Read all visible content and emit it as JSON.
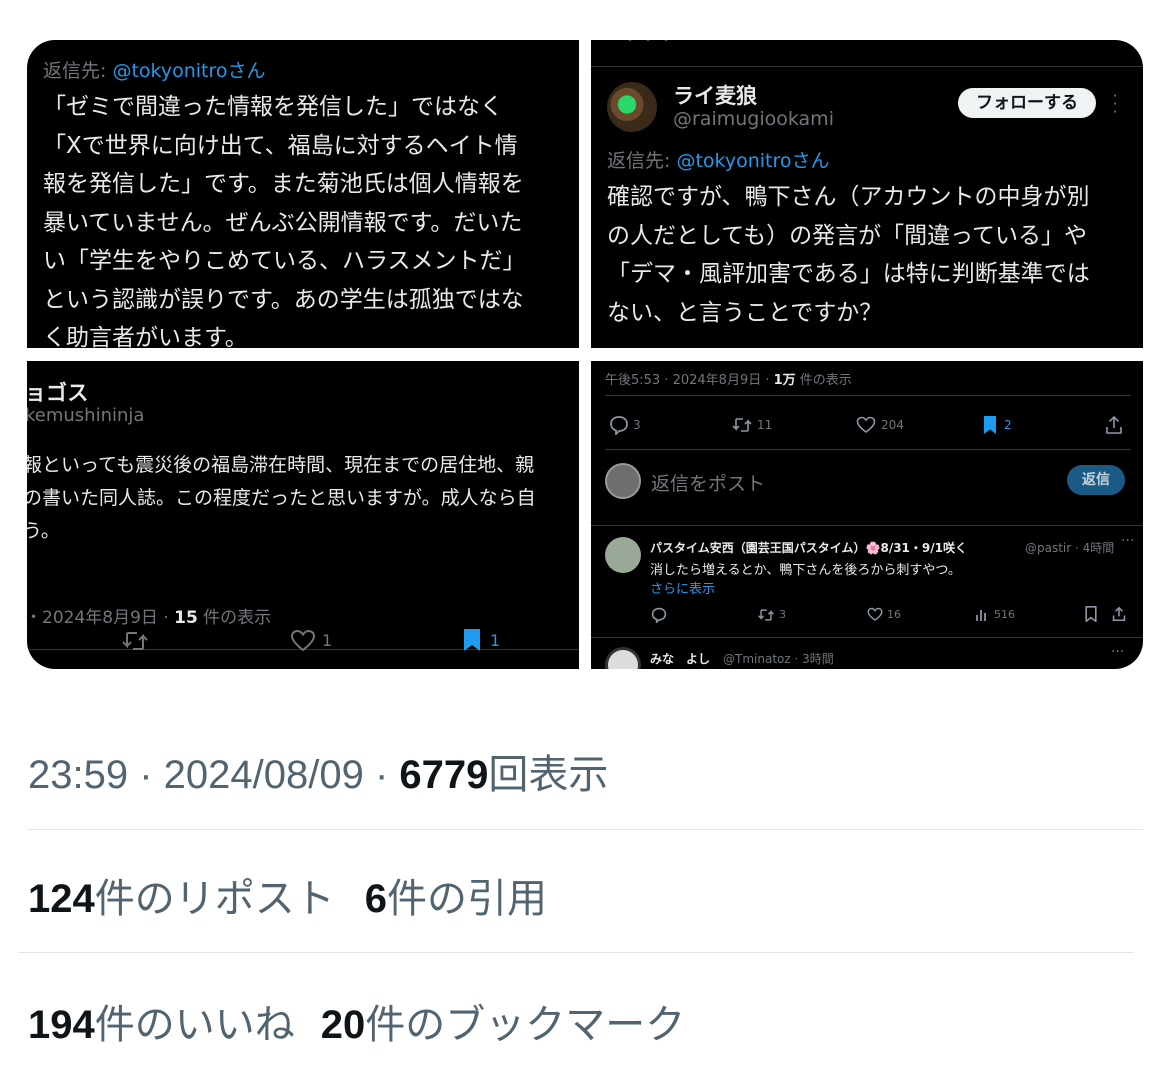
{
  "q1": {
    "reply_to_prefix": "返信先: ",
    "reply_to_user": "@tokyonitroさん",
    "lines": [
      "「ゼミで間違った情報を発信した」ではなく",
      "「Xで世界に向け出て、福島に対するヘイト情",
      "報を発信した」です。また菊池氏は個人情報を",
      "暴いていません。ぜんぶ公開情報です。だいた",
      "い「学生をやりこめている、ハラスメントだ」",
      "という認識が誤りです。あの学生は孤独ではな",
      "く助言者がいます。"
    ]
  },
  "q2": {
    "top_partial": "・・・",
    "name": "ライ麦狼",
    "handle": "@raimugiookami",
    "follow_label": "フォローする",
    "reply_to_prefix": "返信先: ",
    "reply_to_user": "@tokyonitroさん",
    "lines": [
      "確認ですが、鴨下さん（アカウントの中身が別",
      "の人だとしても）の発言が「間違っている」や",
      "「デマ・風評加害である」は特に判断基準では",
      "ない、と言うことですか？"
    ]
  },
  "q3": {
    "name_partial": "ョゴス",
    "handle_partial": "kemushininja",
    "lines": [
      "報といっても震災後の福島滞在時間、現在までの居住地、親",
      "の書いた同人誌。この程度だったと思いますが。成人なら自",
      "う。"
    ],
    "timestamp_prefix": "・2024年8月9日 · ",
    "views_count": "15",
    "views_suffix": " 件の表示",
    "likes": "1",
    "bookmarks": "1"
  },
  "q4": {
    "timestamp": "午後5:53 · 2024年8月9日 · ",
    "views_count": "1万",
    "views_suffix": " 件の表示",
    "replies": "3",
    "reposts": "11",
    "likes": "204",
    "bookmarks": "2",
    "reply_placeholder": "返信をポスト",
    "reply_button": "返信",
    "reply1": {
      "name": "パスタイム安西（園芸王国パスタイム）🌸8/31・9/1咲く",
      "handle_time": "@pastir · 4時間",
      "text": "消したら増えるとか、鴨下さんを後ろから刺すやつ。",
      "show_more": "さらに表示",
      "reposts": "3",
      "likes": "16",
      "views": "516"
    },
    "reply2": {
      "name": "みな　よし",
      "handle_time": "@Tminatoz · 3時間"
    }
  },
  "meta": {
    "time": "23:59",
    "sep": " · ",
    "date": "2024/08/09",
    "views": "6779",
    "views_label": "回表示"
  },
  "stats": {
    "reposts": "124",
    "reposts_label": "件のリポスト",
    "quotes": "6",
    "quotes_label": "件の引用",
    "likes": "194",
    "likes_label": "件のいいね",
    "bookmarks": "20",
    "bookmarks_label": "件のブックマーク"
  }
}
